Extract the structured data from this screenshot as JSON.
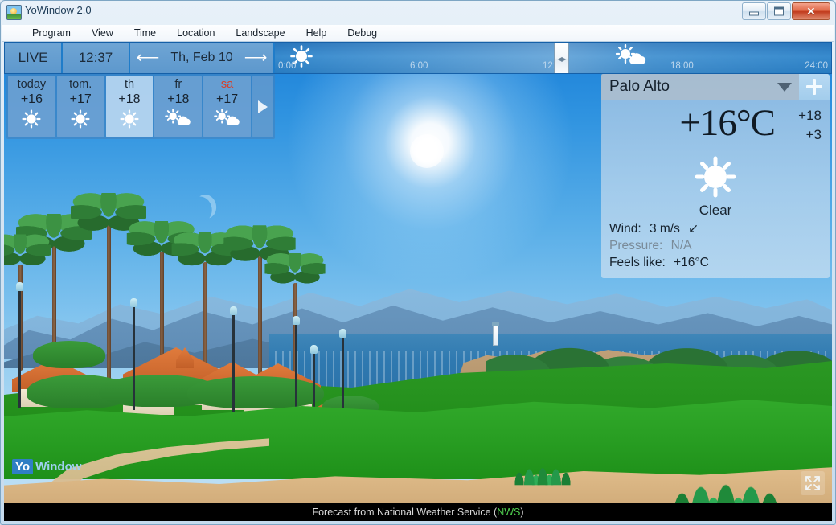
{
  "window": {
    "title": "YoWindow 2.0",
    "icon": "yowindow-app-icon",
    "buttons": {
      "minimize": "–",
      "maximize": "□",
      "close": "✕"
    }
  },
  "menu": {
    "items": [
      {
        "label": "Program"
      },
      {
        "label": "View"
      },
      {
        "label": "Time"
      },
      {
        "label": "Location"
      },
      {
        "label": "Landscape"
      },
      {
        "label": "Help"
      },
      {
        "label": "Debug"
      }
    ]
  },
  "toolbar": {
    "live_label": "LIVE",
    "clock": "12:37",
    "prev_icon": "arrow-left-icon",
    "date": "Th, Feb 10",
    "next_icon": "arrow-right-icon"
  },
  "timeline": {
    "ticks": [
      "0:00",
      "6:00",
      "12:00",
      "18:00",
      "24:00"
    ],
    "icons": [
      {
        "name": "sun-icon",
        "at": "0:00"
      },
      {
        "name": "sun-behind-cloud-icon",
        "at": "18:00"
      }
    ],
    "handle_position": "12:00",
    "handle_icon": "drag-handle-icon"
  },
  "forecast": {
    "days": [
      {
        "name": "today",
        "temp": "+16",
        "icon": "sun-icon",
        "weekend": false,
        "selected": false
      },
      {
        "name": "tom.",
        "temp": "+17",
        "icon": "sun-icon",
        "weekend": false,
        "selected": false
      },
      {
        "name": "th",
        "temp": "+18",
        "icon": "sun-icon",
        "weekend": false,
        "selected": true
      },
      {
        "name": "fr",
        "temp": "+18",
        "icon": "sun-behind-cloud-icon",
        "weekend": false,
        "selected": false
      },
      {
        "name": "sa",
        "temp": "+17",
        "icon": "sun-behind-cloud-icon",
        "weekend": true,
        "selected": false
      }
    ],
    "next_button_icon": "chevron-right-icon"
  },
  "weather_panel": {
    "location": "Palo Alto",
    "location_caret_icon": "chevron-down-icon",
    "add_location_icon": "plus-icon",
    "temperature": "+16°C",
    "high": "+18",
    "low": "+3",
    "condition_icon": "sun-icon",
    "condition": "Clear",
    "details": [
      {
        "label": "Wind:",
        "value": "3 m/s",
        "arrow": "↙",
        "dim": false
      },
      {
        "label": "Pressure:",
        "value": "N/A",
        "arrow": "",
        "dim": true
      },
      {
        "label": "Feels like:",
        "value": "+16°C",
        "arrow": "",
        "dim": false
      }
    ]
  },
  "scene": {
    "landscape_name": "seaside-resort-landscape",
    "sun_icon": "sun-in-sky",
    "moon_icon": "crescent-moon"
  },
  "footer": {
    "logo_yo": "Yo",
    "logo_window": "Window",
    "fullscreen_icon": "fullscreen-icon",
    "status_prefix": "Forecast from National Weather Service (",
    "status_source": "NWS",
    "status_suffix": ")"
  },
  "colors": {
    "accent": "#1f7cc9",
    "sky_top": "#1b80d8",
    "nws_green": "#4fd04f",
    "weekend_red": "#d6402a"
  }
}
